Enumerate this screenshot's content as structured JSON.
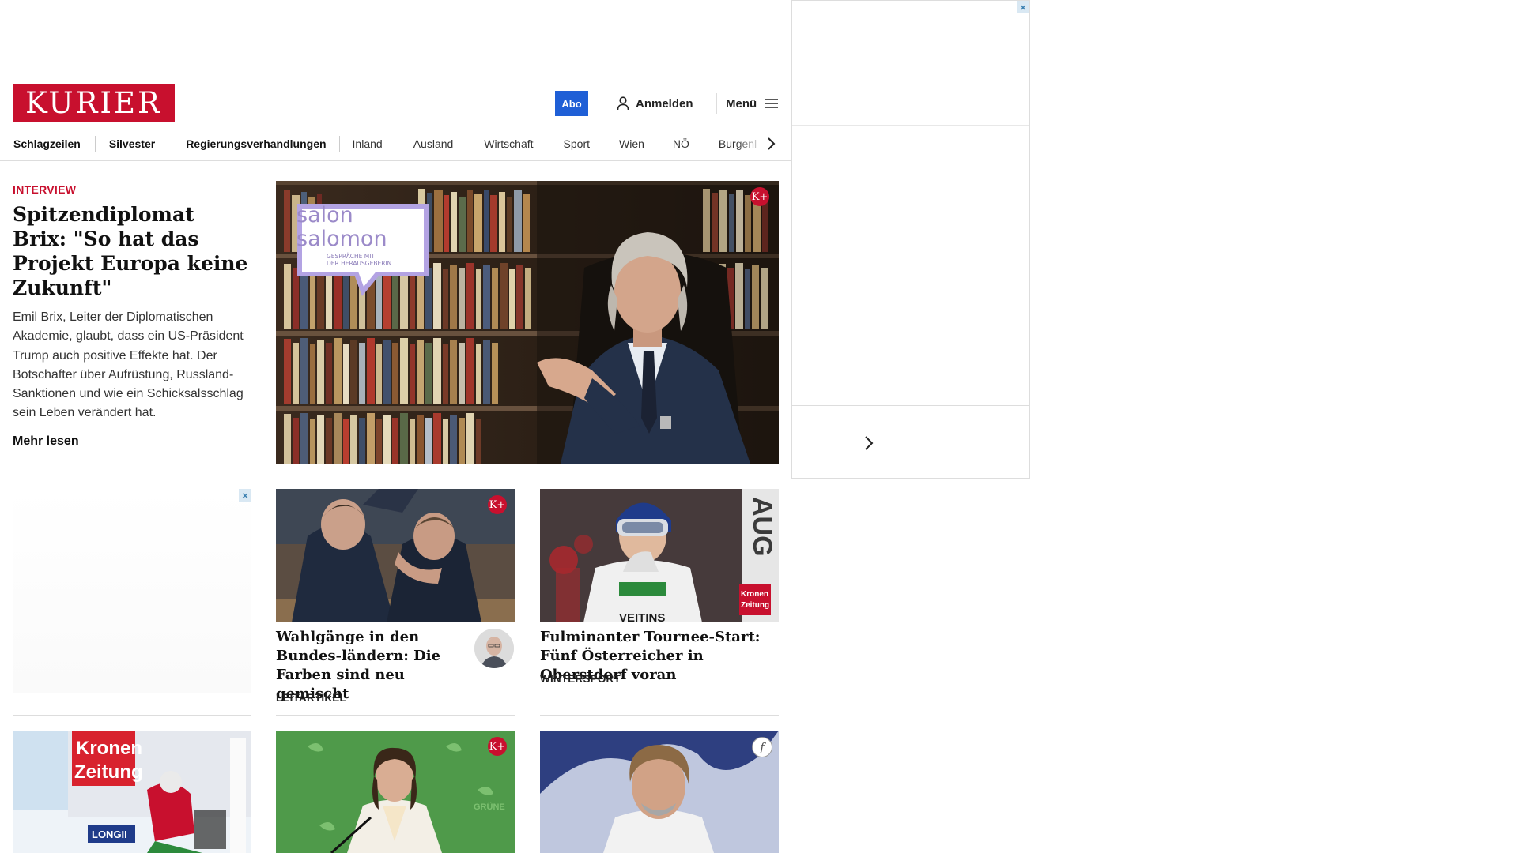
{
  "header": {
    "logo": "KURIER",
    "abo_label": "Abo",
    "login_label": "Anmelden",
    "menu_label": "Menü",
    "brand_color": "#c8102e",
    "abo_color": "#1f5fd6"
  },
  "nav": {
    "items": [
      "Schlagzeilen",
      "Silvester",
      "Regierungsverhandlungen",
      "Inland",
      "Ausland",
      "Wirtschaft",
      "Sport",
      "Wien",
      "NÖ",
      "Burgenl"
    ]
  },
  "hero": {
    "kicker": "INTERVIEW",
    "title": "Spitzendiplomat Brix: \"So hat das Projekt Europa keine Zukunft\"",
    "lead": "Emil Brix, Leiter der Diplomatischen Akademie, glaubt, dass ein US-Präsident Trump auch positive Effekte hat. Der Botschafter über Aufrüstung, Russland-Sanktionen und wie ein Schicksalsschlag sein Leben verändert hat.",
    "more": "Mehr lesen",
    "badge": "K+",
    "overlay_line1": "salon",
    "overlay_line2": "salomon",
    "overlay_sub1": "GESPRÄCHE MIT",
    "overlay_sub2": "DER HERAUSGEBERIN"
  },
  "cards": [
    {
      "title": "Wahlgänge in den Bundes-ländern: Die Farben sind neu gemischt",
      "kicker": "LEITARTIKEL",
      "badge": "K+"
    },
    {
      "title": "Fulminanter Tournee-Start: Fünf Österreicher in Oberstdorf voran",
      "kicker": "WINTERSPORT",
      "img_text": "AUG",
      "sponsor1": "Kronen",
      "sponsor2": "Zeitung",
      "brand": "VEITINS"
    }
  ],
  "bottom_cards": [
    {
      "sponsor1": "Kronen",
      "sponsor2": "Zeitung",
      "banner": "LONGII"
    },
    {
      "badge": "K+",
      "bg_text": "GRÜNE"
    },
    {
      "badge": "f"
    }
  ],
  "ads": {
    "close": "×"
  }
}
